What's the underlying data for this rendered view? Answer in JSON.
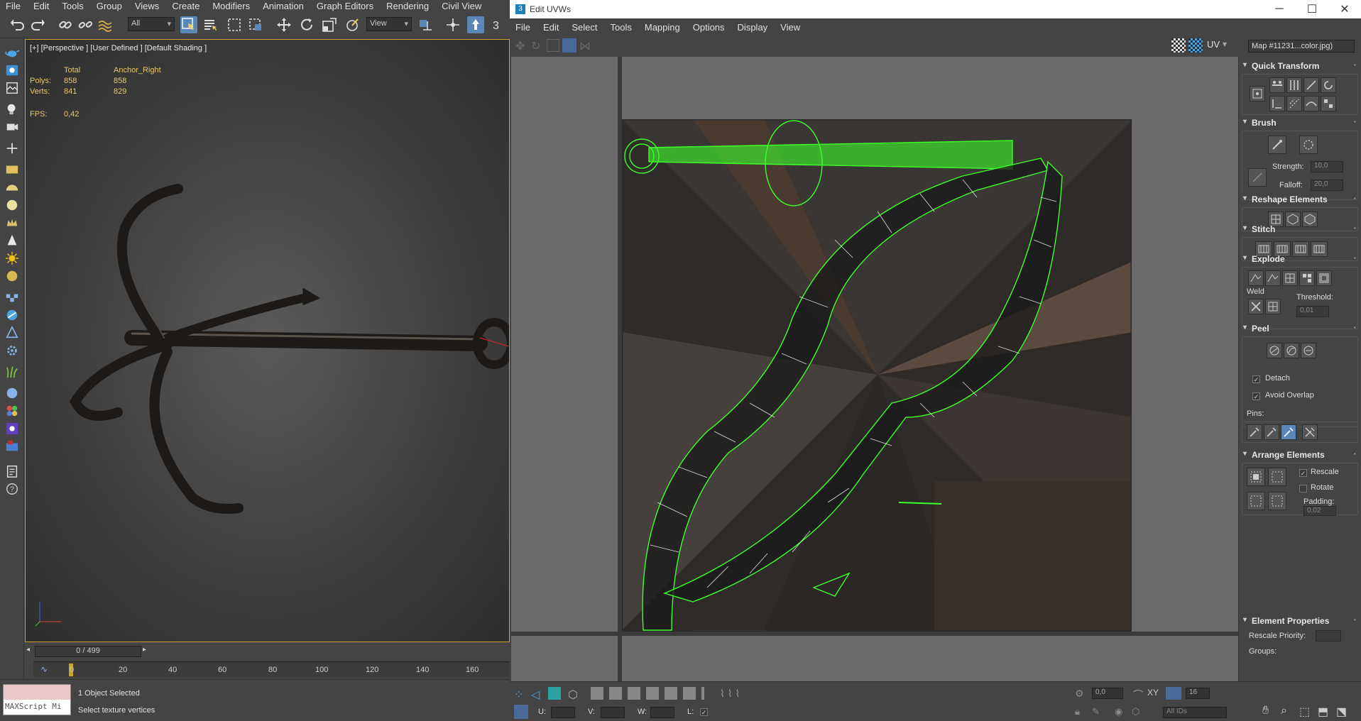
{
  "max": {
    "menu": [
      "File",
      "Edit",
      "Tools",
      "Group",
      "Views",
      "Create",
      "Modifiers",
      "Animation",
      "Graph Editors",
      "Rendering",
      "Civil View"
    ],
    "toolbar": {
      "selection_filter": "All",
      "ref_coord": "View"
    },
    "viewport": {
      "label": "[+] [Perspective ] [User Defined ] [Default Shading ]",
      "stats": {
        "header_total": "Total",
        "header_object": "Anchor_Right",
        "polys_label": "Polys:",
        "polys_total": "858",
        "polys_object": "858",
        "verts_label": "Verts:",
        "verts_total": "841",
        "verts_object": "829",
        "fps_label": "FPS:",
        "fps_value": "0,42"
      }
    },
    "timeline": {
      "slider": "0 / 499",
      "ticks": [
        "0",
        "20",
        "40",
        "60",
        "80",
        "100",
        "120",
        "140",
        "160"
      ]
    },
    "status": {
      "maxscript": "MAXScript Mi",
      "selection": "1 Object Selected",
      "prompt": "Select texture vertices"
    }
  },
  "uvw": {
    "title": "Edit UVWs",
    "menu": [
      "File",
      "Edit",
      "Select",
      "Tools",
      "Mapping",
      "Options",
      "Display",
      "View"
    ],
    "uv_label": "UV",
    "map_dropdown": "Map #11231...color.jpg)",
    "bottom": {
      "u_label": "U:",
      "v_label": "V:",
      "w_label": "W:",
      "l_label": "L:",
      "value": "0,0",
      "xy": "XY",
      "grid": "16",
      "ids": "All IDs"
    },
    "panel": {
      "quick_transform": "Quick Transform",
      "brush": "Brush",
      "strength_label": "Strength:",
      "strength_value": "10,0",
      "falloff_label": "Falloff:",
      "falloff_value": "20,0",
      "reshape": "Reshape Elements",
      "stitch": "Stitch",
      "explode": "Explode",
      "weld": "Weld",
      "threshold_label": "Threshold:",
      "threshold_value": "0,01",
      "peel": "Peel",
      "detach": "Detach",
      "avoid_overlap": "Avoid Overlap",
      "pins": "Pins:",
      "arrange": "Arrange Elements",
      "rescale": "Rescale",
      "rotate": "Rotate",
      "padding_label": "Padding:",
      "padding_value": "0,02",
      "element_props": "Element Properties",
      "rescale_priority": "Rescale Priority:",
      "groups": "Groups:"
    }
  },
  "colors": {
    "accent_select": "#5a86b8",
    "uv_wire": "#3dff2a",
    "viewport_border": "#c9a227"
  }
}
